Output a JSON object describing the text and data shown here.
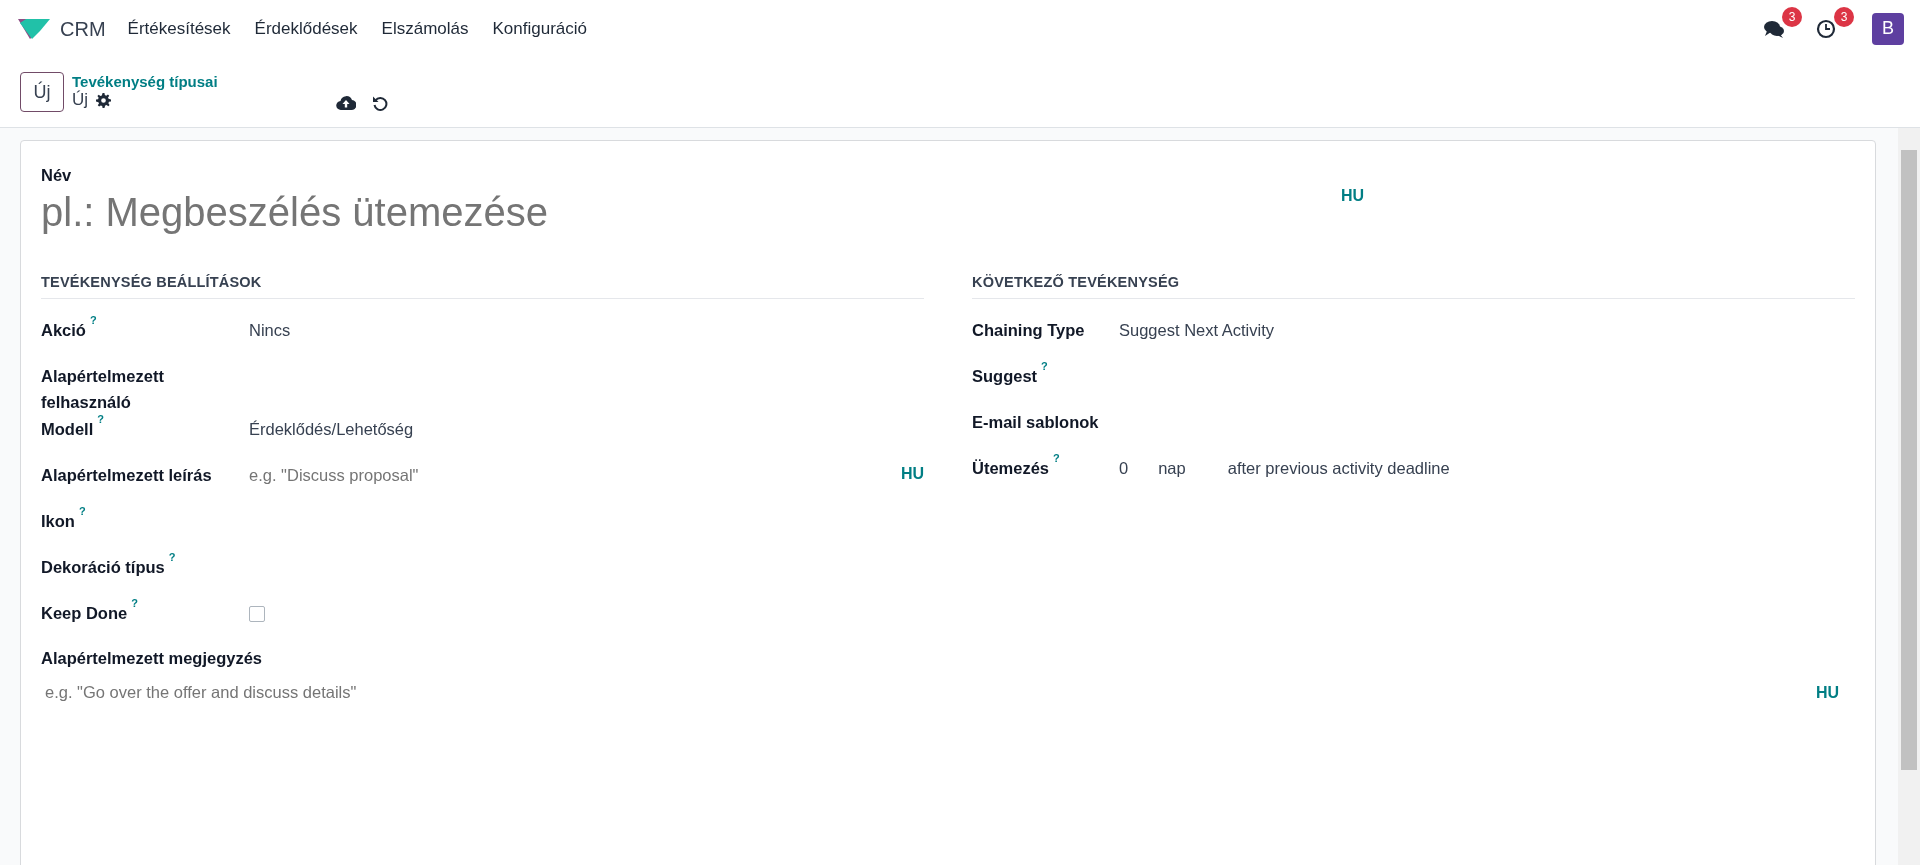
{
  "navbar": {
    "app": "CRM",
    "menu": [
      "Értékesítések",
      "Érdeklődések",
      "Elszámolás",
      "Konfiguráció"
    ],
    "notifications": [
      {
        "kind": "chat",
        "count": "3"
      },
      {
        "kind": "clock",
        "count": "3"
      }
    ],
    "avatar": "B"
  },
  "control_panel": {
    "new_button": "Új",
    "breadcrumb": "Tevékenység típusai",
    "current": "Új"
  },
  "form": {
    "name_label": "Név",
    "name_placeholder": "pl.: Megbeszélés ütemezése",
    "name_lang": "HU",
    "left_section": {
      "title": "TEVÉKENYSÉG BEÁLLÍTÁSOK",
      "fields": [
        {
          "label": "Akció",
          "help": "?",
          "kind": "text",
          "value": "Nincs"
        },
        {
          "label": "Alapértelmezett felhasználó",
          "kind": "empty"
        },
        {
          "label": "Modell",
          "help": "?",
          "kind": "text",
          "value": "Érdeklődés/Lehetőség"
        },
        {
          "label": "Alapértelmezett leírás",
          "kind": "placeholder",
          "placeholder": "e.g. \"Discuss proposal\"",
          "lang": "HU"
        },
        {
          "label": "Ikon",
          "help": "?",
          "kind": "empty"
        },
        {
          "label": "Dekoráció típus",
          "help": "?",
          "kind": "empty"
        },
        {
          "label": "Keep Done",
          "help": "?",
          "kind": "checkbox",
          "checked": false
        }
      ]
    },
    "right_section": {
      "title": "KÖVETKEZŐ TEVÉKENYSÉG",
      "fields": [
        {
          "label": "Chaining Type",
          "kind": "text",
          "value": "Suggest Next Activity"
        },
        {
          "label": "Suggest",
          "help": "?",
          "kind": "empty"
        },
        {
          "label": "E-mail sablonok",
          "kind": "empty"
        },
        {
          "label": "Ütemezés",
          "help": "?",
          "kind": "schedule",
          "parts": [
            "0",
            "nap",
            "after previous activity deadline"
          ]
        }
      ]
    },
    "note": {
      "label": "Alapértelmezett megjegyzés",
      "placeholder": "e.g. \"Go over the offer and discuss details\"",
      "lang": "HU"
    }
  }
}
